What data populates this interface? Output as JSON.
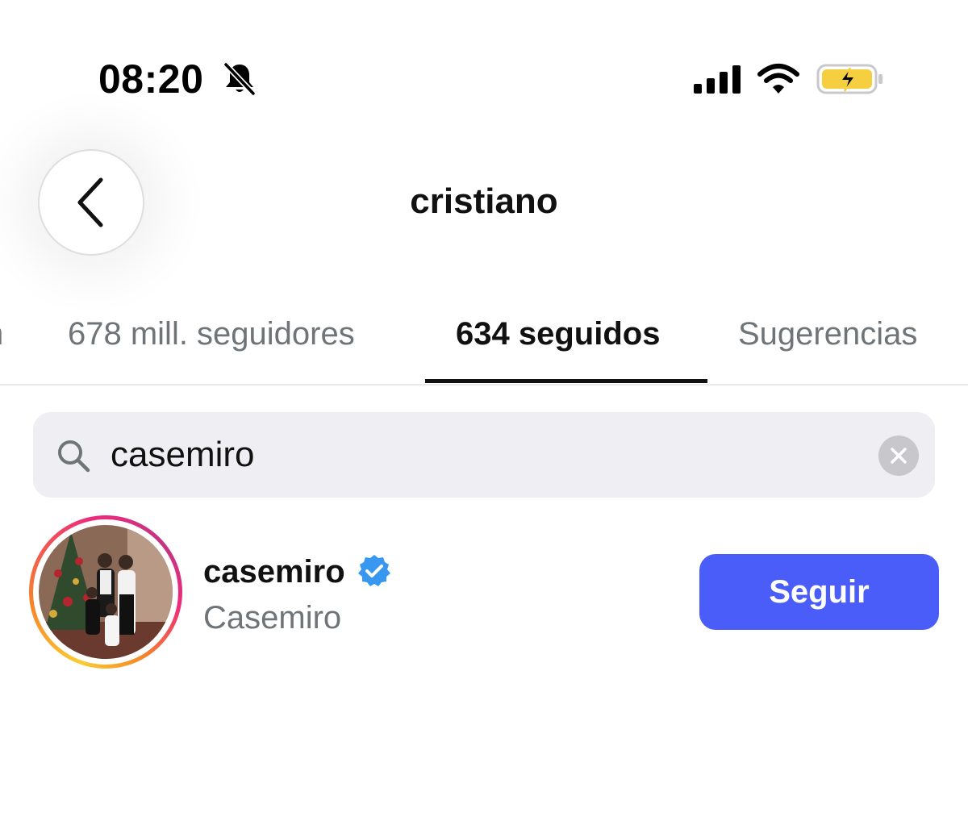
{
  "status_bar": {
    "time": "08:20",
    "icons": [
      "bell-slash-icon",
      "cellular-signal-icon",
      "wifi-icon",
      "battery-charging-icon"
    ],
    "battery_color": "#f5cf3f"
  },
  "header": {
    "back_icon": "chevron-left-icon",
    "title": "cristiano"
  },
  "tabs": [
    {
      "label": "n",
      "active": false
    },
    {
      "label": "678 mill. seguidores",
      "active": false
    },
    {
      "label": "634 seguidos",
      "active": true
    },
    {
      "label": "Sugerencias",
      "active": false
    }
  ],
  "search": {
    "value": "casemiro",
    "icon": "search-icon",
    "clear_icon": "clear-x-icon"
  },
  "results": [
    {
      "username": "casemiro",
      "full_name": "Casemiro",
      "verified": true,
      "button_label": "Seguir"
    }
  ],
  "colors": {
    "accent": "#4a5df9",
    "verified": "#3897f0",
    "secondary_text": "#6f7479",
    "search_bg": "#efeff3"
  }
}
